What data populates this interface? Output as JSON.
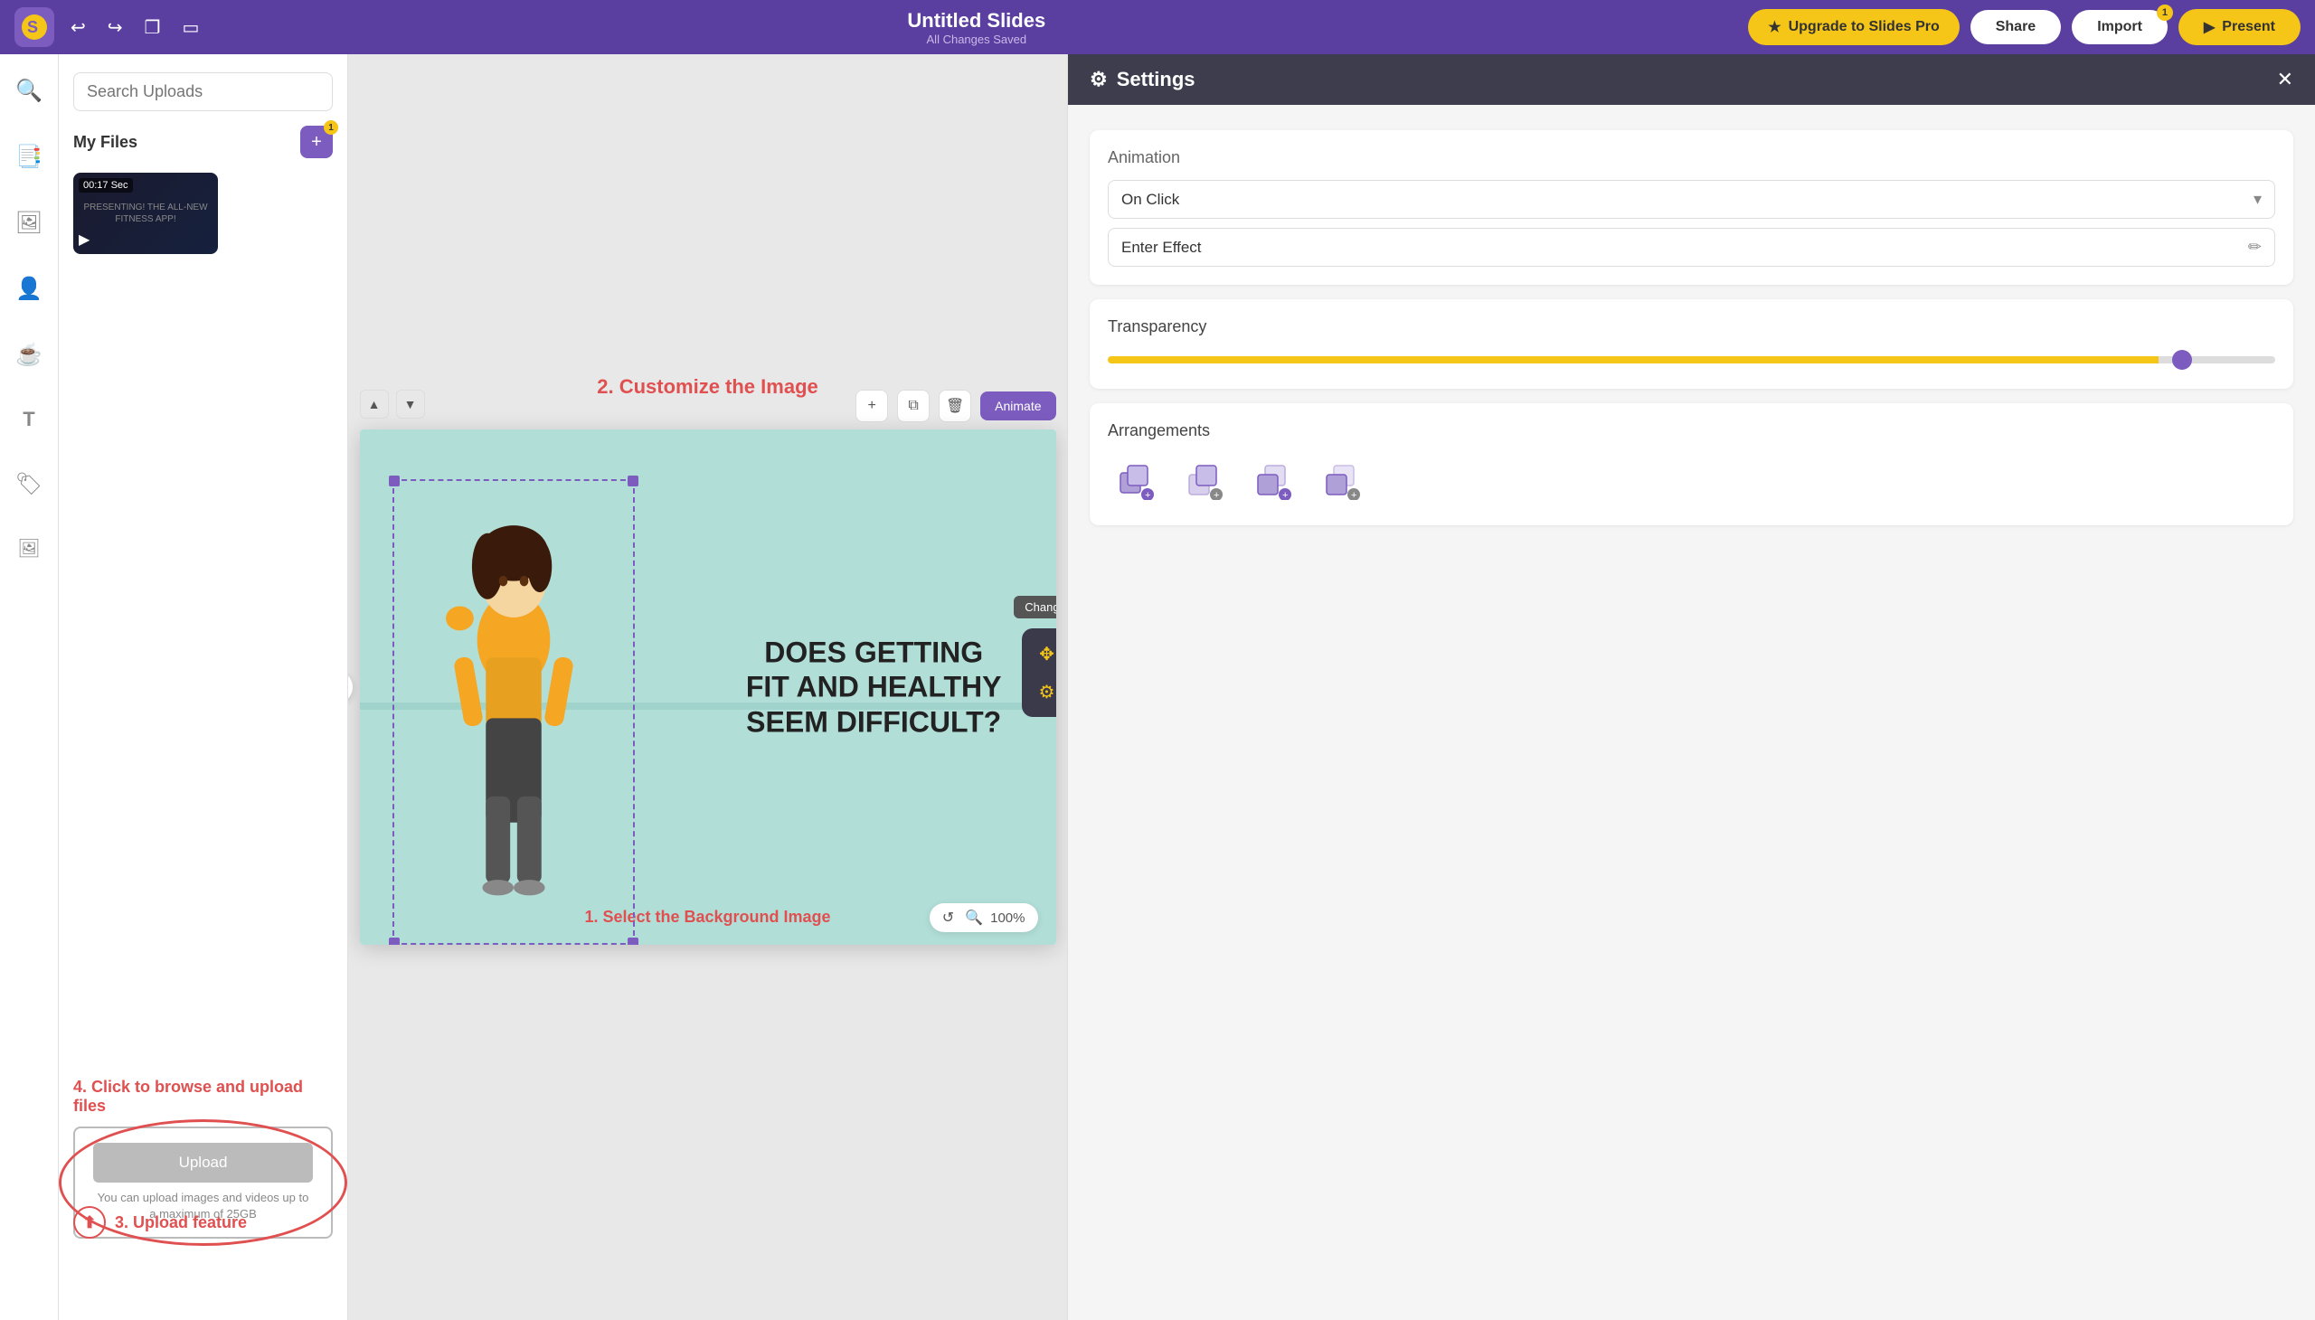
{
  "topbar": {
    "title": "Untitled Slides",
    "subtitle": "All Changes Saved",
    "upgrade_label": "Upgrade to Slides Pro",
    "share_label": "Share",
    "import_label": "Import",
    "present_label": "Present",
    "import_badge": "1"
  },
  "upload_panel": {
    "search_placeholder": "Search Uploads",
    "my_files_label": "My Files",
    "video_time": "00:17 Sec",
    "video_label": "PRESENTING! THE ALL-NEW FITNESS APP!",
    "annotation_4": "4. Click to browse and upload files",
    "upload_btn_label": "Upload",
    "upload_hint": "You can upload images and videos up to a maximum of 25GB",
    "annotation_3": "3. Upload feature"
  },
  "canvas": {
    "slide_text_line1": "DOES GETTING",
    "slide_text_line2": "FIT AND HEALTHY",
    "slide_text_line3": "SEEM DIFFICULT?",
    "footer_text": "1. Select the Background Image",
    "header_annotation": "2. Customize the Image",
    "zoom_level": "100%"
  },
  "element_toolbar": {
    "tooltip": "Change Color"
  },
  "settings": {
    "title": "Settings",
    "animation_label": "Animation",
    "on_click_label": "On Click",
    "enter_effect_label": "Enter Effect",
    "transparency_label": "Transparency",
    "transparency_value": 90,
    "arrangements_label": "Arrangements",
    "arrangements": [
      {
        "icon": "bring-front",
        "badge": "+"
      },
      {
        "icon": "bring-forward",
        "badge": "+"
      },
      {
        "icon": "send-backward",
        "badge": "+"
      },
      {
        "icon": "send-back",
        "badge": "+"
      }
    ]
  },
  "icons": {
    "search": "🔍",
    "slides": "📑",
    "image": "🖼",
    "person": "👤",
    "coffee": "☕",
    "text": "T",
    "badge": "🏷",
    "upload": "⬆",
    "gear": "⚙",
    "close": "✕",
    "chevron_down": "▾",
    "pencil": "✏",
    "plus": "+",
    "copy": "⧉",
    "trash": "🗑",
    "move": "✥",
    "palette": "🎨",
    "settings_gear": "⚙",
    "up": "▲",
    "down": "▼",
    "left": "◀",
    "play": "▶",
    "undo": "↩",
    "redo": "↪",
    "duplicate": "❐",
    "present_play": "▶"
  }
}
